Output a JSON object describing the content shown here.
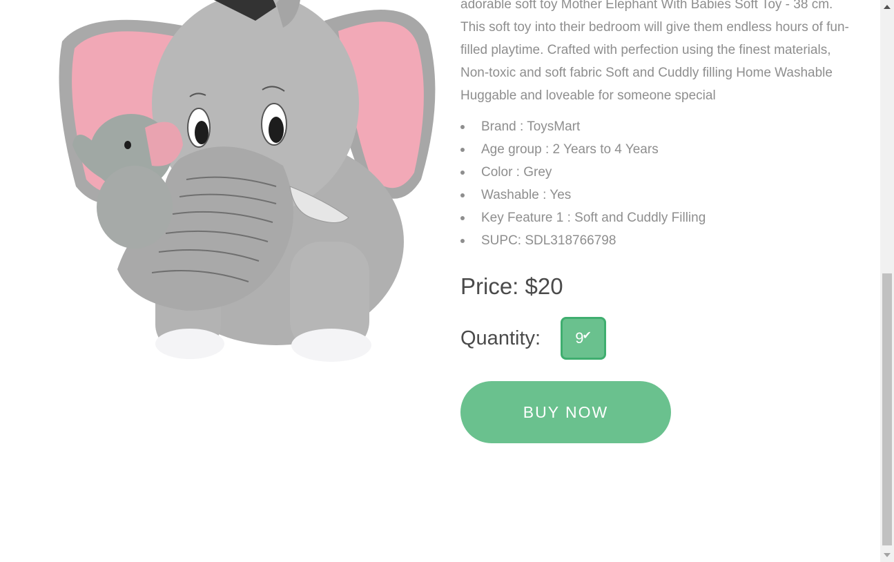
{
  "product": {
    "image_name": "elephant-plush-image",
    "description": "adorable soft toy Mother Elephant With Babies Soft Toy - 38 cm. This soft toy into their bedroom will give them endless hours of fun-filled playtime. Crafted with perfection using the finest materials, Non-toxic and soft fabric Soft and Cuddly filling Home Washable Huggable and loveable for someone special",
    "specs": [
      "Brand : ToysMart",
      "Age group : 2 Years to 4 Years",
      "Color : Grey",
      "Washable : Yes",
      "Key Feature 1 : Soft and Cuddly Filling",
      "SUPC: SDL318766798"
    ],
    "price_label": "Price: $20",
    "quantity_label": "Quantity:",
    "quantity_value": "9",
    "buy_label": "BUY NOW"
  },
  "colors": {
    "accent": "#6ac18e",
    "accent_border": "#3fae6f",
    "text_muted": "#8e8e8e",
    "text_dark": "#4a4a4a"
  },
  "scrollbar": {
    "up_icon": "scroll-up-arrow",
    "down_icon": "scroll-down-arrow"
  }
}
